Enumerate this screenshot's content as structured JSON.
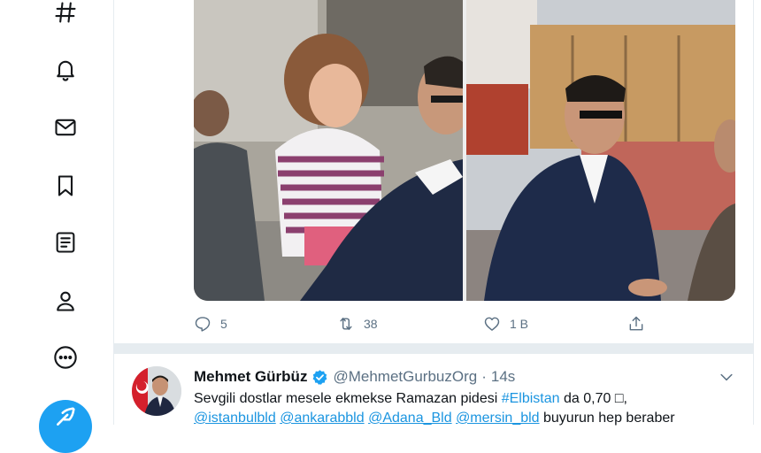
{
  "nav": {
    "items": [
      {
        "icon": "hashtag-icon"
      },
      {
        "icon": "bell-icon"
      },
      {
        "icon": "mail-icon"
      },
      {
        "icon": "bookmark-icon"
      },
      {
        "icon": "list-icon"
      },
      {
        "icon": "profile-icon"
      },
      {
        "icon": "more-icon"
      }
    ],
    "compose_icon": "feather-icon"
  },
  "tweet1": {
    "actions": {
      "reply_count": "5",
      "retweet_count": "38",
      "like_count": "1 B"
    }
  },
  "tweet2": {
    "name": "Mehmet Gürbüz",
    "handle": "@MehmetGurbuzOrg",
    "separator": "·",
    "time": "14s",
    "text_line1": {
      "before": "Sevgili dostlar mesele ekmekse Ramazan pidesi ",
      "hashtag": "#Elbistan",
      "after": " da 0,70 □,"
    },
    "text_line2": {
      "mention1": "@istanbulbld",
      "mention2": "@ankarabbld",
      "mention3": "@Adana_Bld",
      "mention4": "@mersin_bld",
      "after": " buyurun hep beraber"
    }
  },
  "colors": {
    "accent": "#1da1f2",
    "link": "#1b95e0",
    "secondary_text": "#5b7083",
    "divider": "#e6ecf0"
  }
}
